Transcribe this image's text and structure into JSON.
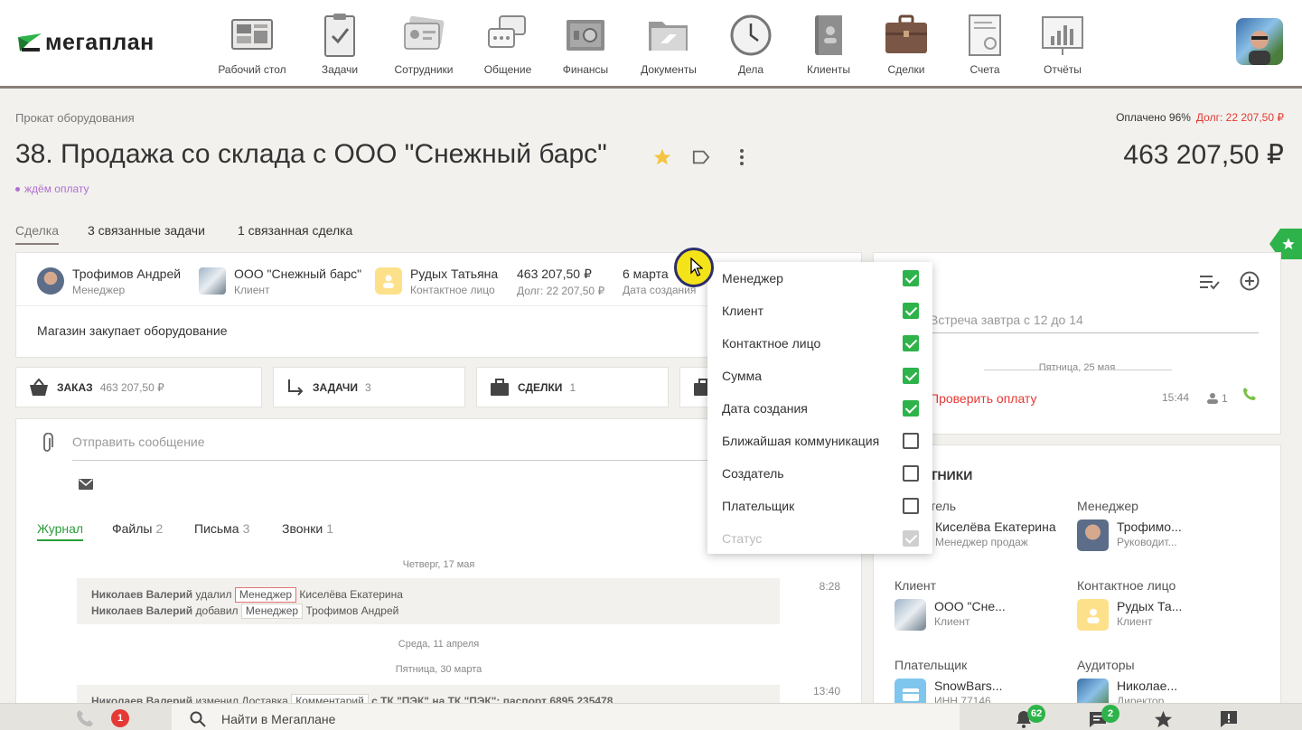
{
  "app": {
    "logo": "мегаплан"
  },
  "nav": [
    {
      "label": "Рабочий стол",
      "icon": "desktop-icon"
    },
    {
      "label": "Задачи",
      "icon": "tasks-icon"
    },
    {
      "label": "Сотрудники",
      "icon": "employees-icon"
    },
    {
      "label": "Общение",
      "icon": "chat-icon"
    },
    {
      "label": "Финансы",
      "icon": "safe-icon"
    },
    {
      "label": "Документы",
      "icon": "folder-icon"
    },
    {
      "label": "Дела",
      "icon": "clock-icon"
    },
    {
      "label": "Клиенты",
      "icon": "contacts-book-icon"
    },
    {
      "label": "Сделки",
      "icon": "briefcase-icon"
    },
    {
      "label": "Счета",
      "icon": "invoice-icon"
    },
    {
      "label": "Отчёты",
      "icon": "reports-icon"
    }
  ],
  "deal": {
    "breadcrumb": "Прокат оборудования",
    "paid": "Оплачено 96%",
    "debt": "Долг: 22 207,50 ₽",
    "title": "38. Продажа со склада с ООО \"Снежный барс\"",
    "amount": "463 207,50 ₽",
    "status": "ждём оплату"
  },
  "tabs": [
    "Сделка",
    "3 связанные задачи",
    "1 связанная сделка"
  ],
  "summary": {
    "manager": {
      "name": "Трофимов Андрей",
      "role": "Менеджер"
    },
    "client": {
      "name": "ООО \"Снежный барс\"",
      "role": "Клиент"
    },
    "contact": {
      "name": "Рудых Татьяна",
      "role": "Контактное лицо"
    },
    "sum": {
      "value": "463 207,50 ₽",
      "sub": "Долг: 22 207,50 ₽"
    },
    "date": {
      "value": "6 марта",
      "sub": "Дата создания"
    },
    "description": "Магазин закупает оборудование"
  },
  "blocks": [
    {
      "label": "ЗАКАЗ",
      "count": "463 207,50 ₽"
    },
    {
      "label": "ЗАДАЧИ",
      "count": "3"
    },
    {
      "label": "СДЕЛКИ",
      "count": "1"
    }
  ],
  "message": {
    "placeholder": "Отправить сообщение"
  },
  "feed_tabs": [
    {
      "label": "Журнал",
      "count": ""
    },
    {
      "label": "Файлы",
      "count": "2"
    },
    {
      "label": "Письма",
      "count": "3"
    },
    {
      "label": "Звонки",
      "count": "1"
    }
  ],
  "log": {
    "day1": "Четверг, 17 мая",
    "e1": {
      "who": "Николаев Валерий",
      "action": "удалил",
      "tag": "Менеджер",
      "target": "Киселёва Екатерина"
    },
    "e2": {
      "who": "Николаев Валерий",
      "action": "добавил",
      "tag": "Менеджер",
      "target": "Трофимов Андрей"
    },
    "time1": "8:28",
    "day2": "Среда, 11 апреля",
    "day3": "Пятница, 30 марта",
    "e3": {
      "who": "Николаев Валерий",
      "action": "изменил Доставка",
      "tag": "Комментарий",
      "target": "с ТК \"ПЭК\" на ТК \"ПЭК\": паспорт 6895 235478"
    },
    "time2": "13:40"
  },
  "todo": {
    "input_placeholder": "Встреча завтра с 12 до 14",
    "day": "Пятница, 25 мая",
    "task": "Проверить оплату",
    "time": "15:44",
    "count": "1"
  },
  "participants": {
    "title": "ТНИКИ",
    "creator_label": "тель",
    "creator": {
      "name": "Киселёва Екатерина",
      "role": "Менеджер продаж"
    },
    "manager_label": "Менеджер",
    "manager": {
      "name": "Трофимо...",
      "role": "Руководит..."
    },
    "client_label": "Клиент",
    "client": {
      "name": "ООО \"Сне...",
      "role": "Клиент"
    },
    "contact_label": "Контактное лицо",
    "contact": {
      "name": "Рудых Та...",
      "role": "Клиент"
    },
    "payer_label": "Плательщик",
    "payer": {
      "name": "SnowBars...",
      "role": "ИНН 77146..."
    },
    "auditors_label": "Аудиторы",
    "auditor": {
      "name": "Николае...",
      "role": "Директор"
    }
  },
  "dropdown": [
    {
      "label": "Менеджер",
      "state": "on"
    },
    {
      "label": "Клиент",
      "state": "on"
    },
    {
      "label": "Контактное лицо",
      "state": "on"
    },
    {
      "label": "Сумма",
      "state": "on"
    },
    {
      "label": "Дата создания",
      "state": "on"
    },
    {
      "label": "Ближайшая коммуникация",
      "state": "off"
    },
    {
      "label": "Создатель",
      "state": "off"
    },
    {
      "label": "Плательщик",
      "state": "off"
    },
    {
      "label": "Статус",
      "state": "disabled"
    }
  ],
  "bottom": {
    "missed_calls": "1",
    "search_placeholder": "Найти в Мегаплане",
    "notifications": "62",
    "messages": "2"
  },
  "colors": {
    "accent_green": "#2db34a",
    "debt_red": "#e53935",
    "status_purple": "#b06fd0"
  }
}
